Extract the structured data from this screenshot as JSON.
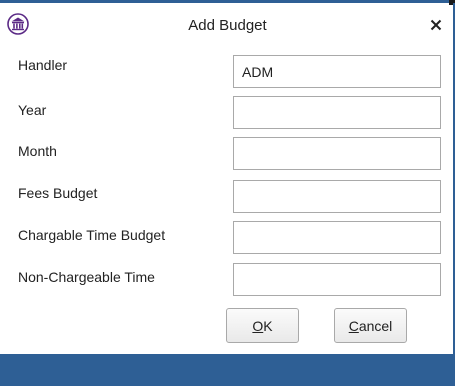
{
  "dialog": {
    "title": "Add Budget",
    "close_glyph": "×",
    "app_icon": "bank-building-icon",
    "accent_color": "#2e5f95",
    "icon_color": "#5b2a86"
  },
  "form": {
    "handler_label": "Handler",
    "handler_value": "ADM",
    "year_label": "Year",
    "year_value": "",
    "month_label": "Month",
    "month_value": "",
    "fees_budget_label": "Fees Budget",
    "fees_budget_value": "",
    "chargeable_time_budget_label": "Chargable Time Budget",
    "chargeable_time_budget_value": "",
    "non_chargeable_time_label": "Non-Chargeable Time",
    "non_chargeable_time_value": ""
  },
  "buttons": {
    "ok_mnemonic": "O",
    "ok_rest": "K",
    "cancel_mnemonic": "C",
    "cancel_rest": "ancel"
  }
}
